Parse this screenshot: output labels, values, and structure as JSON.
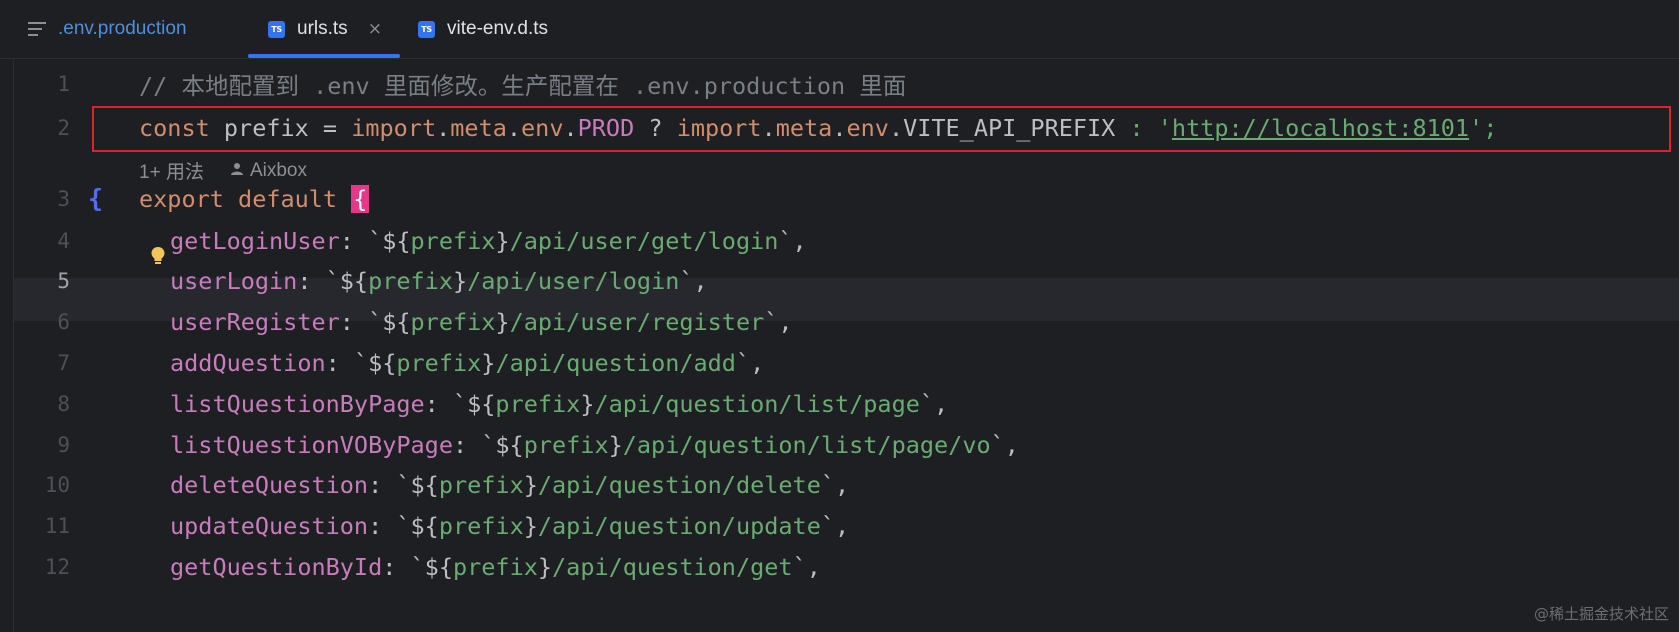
{
  "tabs": [
    {
      "label": ".env.production",
      "icon": "text-file-icon",
      "active": false
    },
    {
      "label": "urls.ts",
      "icon": "ts-file-icon",
      "active": true,
      "close": "×"
    },
    {
      "label": "vite-env.d.ts",
      "icon": "ts-file-icon",
      "active": false
    }
  ],
  "ts_badge": "TS",
  "inlay_hint": {
    "usages": "1+ 用法",
    "author": "Aixbox"
  },
  "lines": [
    {
      "num": "1",
      "text": "// 本地配置到 .env 里面修改。生产配置在 .env.production 里面"
    },
    {
      "num": "2",
      "parts": [
        "const",
        " prefix = ",
        "import",
        ".",
        "meta",
        ".",
        "env",
        ".",
        "PROD",
        " ? ",
        "import",
        ".",
        "meta",
        ".",
        "env",
        ".",
        "VITE_API_PREFIX",
        " : '",
        "http://localhost:8101",
        "';"
      ]
    },
    {
      "num": "3",
      "parts": [
        "export",
        " ",
        "default",
        " ",
        "{"
      ]
    },
    {
      "num": "4",
      "key": "getLoginUser",
      "path": "/api/user/get/login"
    },
    {
      "num": "5",
      "key": "userLogin",
      "path": "/api/user/login"
    },
    {
      "num": "6",
      "key": "userRegister",
      "path": "/api/user/register"
    },
    {
      "num": "7",
      "key": "addQuestion",
      "path": "/api/question/add"
    },
    {
      "num": "8",
      "key": "listQuestionByPage",
      "path": "/api/question/list/page"
    },
    {
      "num": "9",
      "key": "listQuestionVOByPage",
      "path": "/api/question/list/page/vo"
    },
    {
      "num": "10",
      "key": "deleteQuestion",
      "path": "/api/question/delete"
    },
    {
      "num": "11",
      "key": "updateQuestion",
      "path": "/api/question/update"
    },
    {
      "num": "12",
      "key": "getQuestionById",
      "path": "/api/question/get"
    }
  ],
  "tokens": {
    "colon": ": ",
    "backtick_open": "`${",
    "prefix": "prefix",
    "close_brace": "}",
    "backtick_close": "`,",
    "fold_brace": "{"
  },
  "watermark": "@稀土掘金技术社区",
  "colors": {
    "background": "#1e1f22",
    "keyword": "#cf8e6d",
    "property": "#c77dbb",
    "string": "#6aab73",
    "comment": "#7a7e85",
    "text": "#bcbec4",
    "highlight_box": "#d9232d",
    "tab_accent": "#3574f0",
    "brace_highlight": "#e8368a"
  }
}
